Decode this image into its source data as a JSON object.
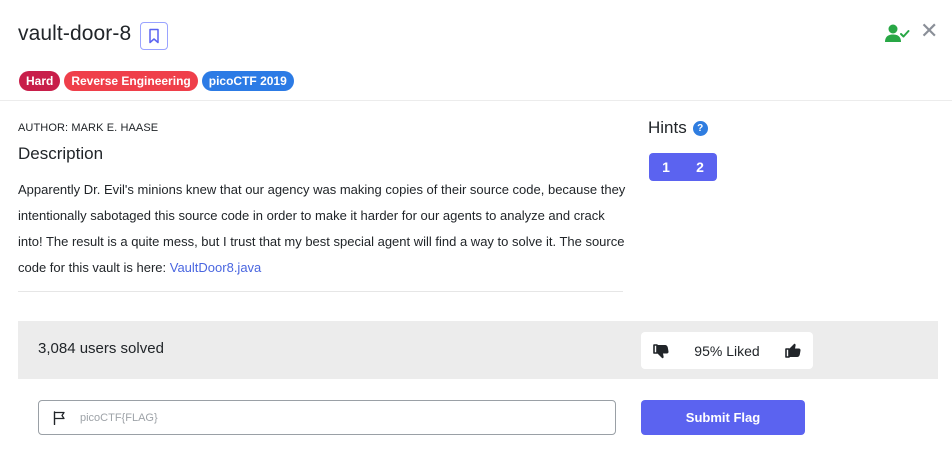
{
  "header": {
    "title": "vault-door-8",
    "close_glyph": "✕"
  },
  "tags": [
    {
      "label": "Hard",
      "color": "#c81e4a"
    },
    {
      "label": "Reverse Engineering",
      "color": "#ef3f4a"
    },
    {
      "label": "picoCTF 2019",
      "color": "#2c7be5"
    }
  ],
  "description": {
    "author": "AUTHOR: MARK E. HAASE",
    "heading": "Description",
    "body": "Apparently Dr. Evil's minions knew that our agency was making copies of their source code, because they intentionally sabotaged this source code in order to make it harder for our agents to analyze and crack into! The result is a quite mess, but I trust that my best special agent will find a way to solve it. The source code for this vault is here: ",
    "link_text": "VaultDoor8.java"
  },
  "hints": {
    "heading": "Hints",
    "help_glyph": "?",
    "items": [
      "1",
      "2"
    ]
  },
  "stats": {
    "solved": "3,084 users solved",
    "liked": "95% Liked"
  },
  "flag": {
    "placeholder": "picoCTF{FLAG}",
    "value": "",
    "submit_label": "Submit Flag"
  },
  "colors": {
    "accent": "#5b63f0",
    "solved_icon": "#28a745",
    "link": "#4a66e0"
  },
  "icons": {
    "bookmark": "bookmark-icon",
    "user_check": "user-check-icon",
    "close": "close-icon",
    "help": "help-icon",
    "flag": "flag-icon",
    "thumbs_down": "thumbs-down-icon",
    "thumbs_up": "thumbs-up-icon"
  }
}
